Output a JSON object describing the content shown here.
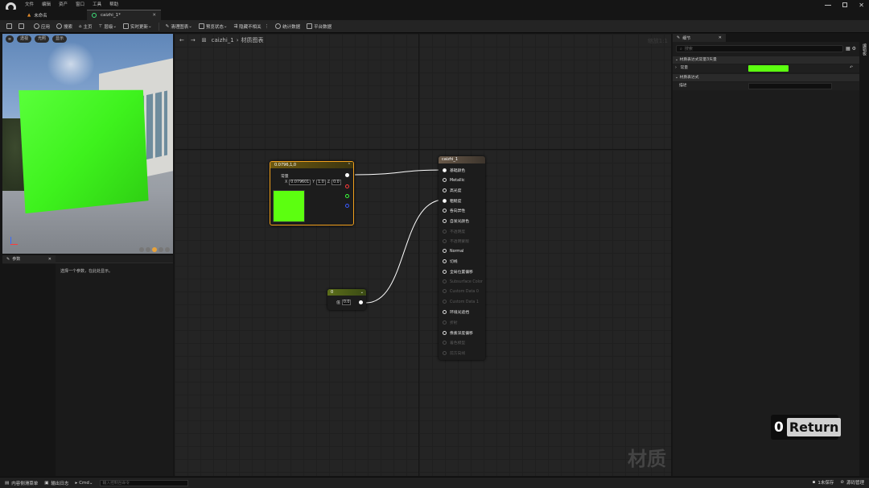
{
  "menubar": {
    "logo": "ue-logo-icon",
    "items": [
      "文件",
      "编辑",
      "资产",
      "窗口",
      "工具",
      "帮助"
    ]
  },
  "tabs": [
    {
      "label": "未命名",
      "icon": "level-icon"
    },
    {
      "label": "caizhi_1*",
      "icon": "material-icon"
    }
  ],
  "toolbar": {
    "apply": "应用",
    "search": "搜索",
    "home": "主页",
    "hierarchy": "层级",
    "live_update": "实时更新",
    "clean_graph": "清理图表",
    "preview_state": "预览状态",
    "hide_unrelated": "隐藏不相关",
    "stats": "统计数据",
    "platform_stats": "平台数据"
  },
  "viewport": {
    "perspective": "透视",
    "lit": "光照",
    "show": "显示",
    "quad_color": "#3ef21d"
  },
  "params_panel": {
    "tab": "参数",
    "hint": "选择一个参数，在此处显示。"
  },
  "graph": {
    "breadcrumb_root": "caizhi_1",
    "breadcrumb_sep": "›",
    "breadcrumb_current": "材质图表",
    "zoom": "缩放1:1",
    "watermark": "材质",
    "const3_node": {
      "title": "0.0796,1,0",
      "output_label": "常量",
      "r_label": "X",
      "r_value": "0.079601",
      "g_label": "Y",
      "g_value": "1.0",
      "b_label": "Z",
      "b_value": "0.0",
      "color": "#5cff10"
    },
    "const_node": {
      "title": "0",
      "value_label": "值",
      "value": "0.0"
    },
    "result_node": {
      "title": "caizhi_1",
      "pins": [
        {
          "label": "基础颜色",
          "active": true,
          "connected": true
        },
        {
          "label": "Metallic",
          "active": true,
          "connected": false
        },
        {
          "label": "高光度",
          "active": true,
          "connected": false
        },
        {
          "label": "粗糙度",
          "active": true,
          "connected": true
        },
        {
          "label": "各向异性",
          "active": true,
          "connected": false
        },
        {
          "label": "自发光颜色",
          "active": true,
          "connected": false
        },
        {
          "label": "不透明度",
          "active": false,
          "connected": false
        },
        {
          "label": "不透明蒙版",
          "active": false,
          "connected": false
        },
        {
          "label": "Normal",
          "active": true,
          "connected": false
        },
        {
          "label": "切线",
          "active": true,
          "connected": false
        },
        {
          "label": "全局位置偏移",
          "active": true,
          "connected": false
        },
        {
          "label": "Subsurface Color",
          "active": false,
          "connected": false
        },
        {
          "label": "Custom Data 0",
          "active": false,
          "connected": false
        },
        {
          "label": "Custom Data 1",
          "active": false,
          "connected": false
        },
        {
          "label": "环境光遮挡",
          "active": true,
          "connected": false
        },
        {
          "label": "折射",
          "active": false,
          "connected": false
        },
        {
          "label": "像素深度偏移",
          "active": true,
          "connected": false
        },
        {
          "label": "着色模型",
          "active": false,
          "connected": false
        },
        {
          "label": "前方向线",
          "active": false,
          "connected": false
        }
      ]
    }
  },
  "details_panel": {
    "tab": "细节",
    "search_placeholder": "搜索",
    "section1": "材质表达式常量3矢量",
    "constant_label": "常量",
    "constant_color": "#5cff10",
    "section2": "材质表达式",
    "desc_label": "描述",
    "side_label": "编辑板"
  },
  "return_badge": {
    "count": "0",
    "label": "Return"
  },
  "statusbar": {
    "content_drawer": "内容侧滑菜单",
    "output_log": "输出日志",
    "cmd": "Cmd",
    "console_placeholder": "输入控制台命令",
    "unsaved": "1未保存",
    "source_control": "源码管理"
  }
}
